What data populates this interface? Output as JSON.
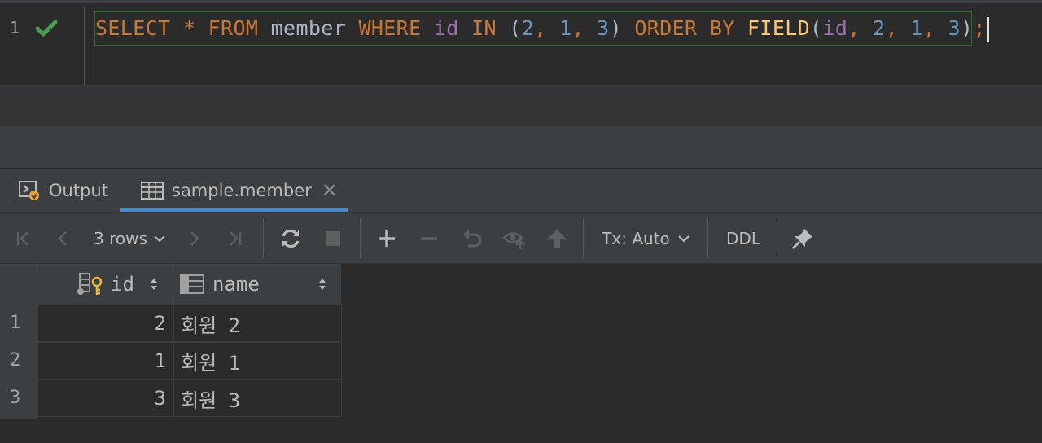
{
  "editor": {
    "line_number": "1",
    "status_icon": "check-icon",
    "code_tokens": [
      {
        "t": "SELECT",
        "c": "kw"
      },
      {
        "t": " ",
        "c": "plain"
      },
      {
        "t": "*",
        "c": "kw"
      },
      {
        "t": " ",
        "c": "plain"
      },
      {
        "t": "FROM",
        "c": "kw"
      },
      {
        "t": " member ",
        "c": "plain"
      },
      {
        "t": "WHERE",
        "c": "kw"
      },
      {
        "t": " ",
        "c": "plain"
      },
      {
        "t": "id",
        "c": "fld"
      },
      {
        "t": " ",
        "c": "plain"
      },
      {
        "t": "IN",
        "c": "kw"
      },
      {
        "t": " (",
        "c": "plain"
      },
      {
        "t": "2",
        "c": "num"
      },
      {
        "t": ", ",
        "c": "kw"
      },
      {
        "t": "1",
        "c": "num"
      },
      {
        "t": ", ",
        "c": "kw"
      },
      {
        "t": "3",
        "c": "num"
      },
      {
        "t": ") ",
        "c": "plain"
      },
      {
        "t": "ORDER BY",
        "c": "kw"
      },
      {
        "t": " ",
        "c": "plain"
      },
      {
        "t": "FIELD",
        "c": "fn"
      },
      {
        "t": "(",
        "c": "plain"
      },
      {
        "t": "id",
        "c": "fld"
      },
      {
        "t": ", ",
        "c": "kw"
      },
      {
        "t": "2",
        "c": "num"
      },
      {
        "t": ", ",
        "c": "kw"
      },
      {
        "t": "1",
        "c": "num"
      },
      {
        "t": ", ",
        "c": "kw"
      },
      {
        "t": "3",
        "c": "num"
      },
      {
        "t": ")",
        "c": "plain"
      },
      {
        "t": ";",
        "c": "kw"
      }
    ]
  },
  "tabs": {
    "output_label": "Output",
    "member_label": "sample.member",
    "close_glyph": "✕"
  },
  "toolbar": {
    "rows_label": "3 rows",
    "tx_label": "Tx: Auto",
    "ddl_label": "DDL"
  },
  "grid": {
    "columns": [
      {
        "label": "id",
        "icon": "primary-key-icon"
      },
      {
        "label": "name",
        "icon": "column-icon"
      }
    ],
    "rows": [
      {
        "num": "1",
        "id": "2",
        "name": "회원 2"
      },
      {
        "num": "2",
        "id": "1",
        "name": "회원 1"
      },
      {
        "num": "3",
        "id": "3",
        "name": "회원 3"
      }
    ]
  },
  "colors": {
    "keyword": "#cc7832",
    "number": "#6897bb",
    "field": "#9876aa",
    "function": "#ffc66d",
    "check": "#499c54",
    "tab_accent": "#4a88c7"
  }
}
